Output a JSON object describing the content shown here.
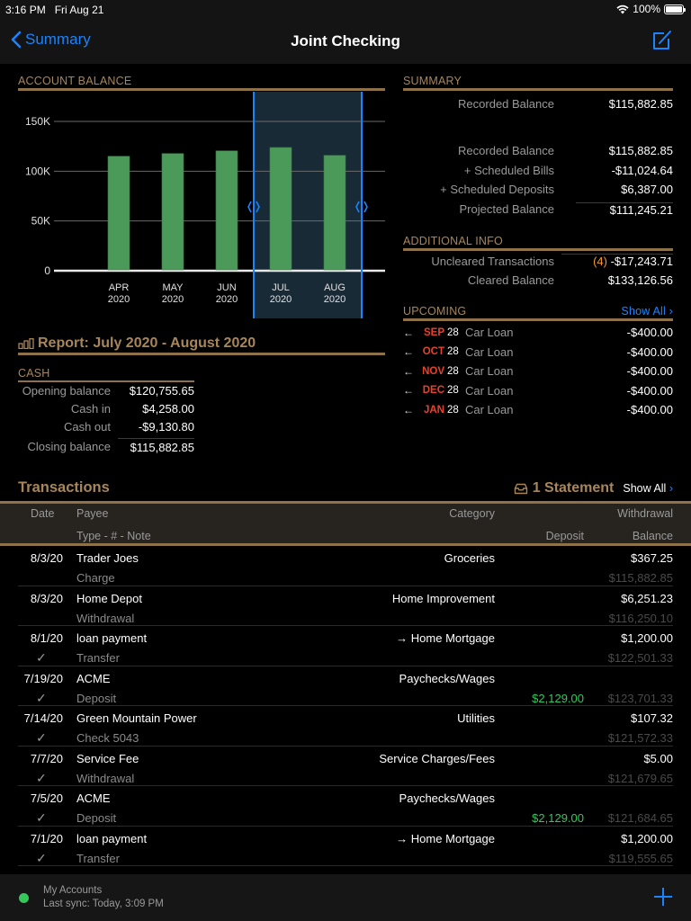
{
  "status_bar": {
    "time": "3:16 PM",
    "date": "Fri Aug 21",
    "battery": "100%",
    "battery_level": 1.0
  },
  "nav": {
    "back_label": "Summary",
    "title": "Joint Checking"
  },
  "colors": {
    "accent": "#1a84ff",
    "gold": "#a8865a",
    "bar": "#4c9a5a",
    "selection": "#192a37",
    "negative_month": "#e5432f",
    "positive": "#34c759",
    "warning": "#f09a28"
  },
  "account_balance": {
    "header": "ACCOUNT BALANCE"
  },
  "chart_data": {
    "type": "bar",
    "title": "ACCOUNT BALANCE",
    "categories": [
      "APR 2020",
      "MAY 2020",
      "JUN 2020",
      "JUL 2020",
      "AUG 2020"
    ],
    "category_lines": [
      [
        "APR",
        "2020"
      ],
      [
        "MAY",
        "2020"
      ],
      [
        "JUN",
        "2020"
      ],
      [
        "JUL",
        "2020"
      ],
      [
        "AUG",
        "2020"
      ]
    ],
    "values": [
      115000,
      117700,
      120400,
      123800,
      115882.85
    ],
    "ylim": [
      0,
      150000
    ],
    "yticks": [
      0,
      50000,
      100000,
      150000
    ],
    "ytick_labels": [
      "0",
      "50K",
      "100K",
      "150K"
    ],
    "grid": true,
    "selected_range": [
      "JUL 2020",
      "AUG 2020"
    ],
    "xlabel": "",
    "ylabel": ""
  },
  "summary": {
    "header": "SUMMARY",
    "top": {
      "label": "Recorded Balance",
      "value": "$115,882.85"
    },
    "rows": [
      {
        "label": "Recorded Balance",
        "value": "$115,882.85"
      },
      {
        "label": "+ Scheduled Bills",
        "value": "-$11,024.64"
      },
      {
        "label": "+ Scheduled Deposits",
        "value": "$6,387.00"
      },
      {
        "label": "Projected Balance",
        "value": "$111,245.21"
      }
    ]
  },
  "additional_info": {
    "header": "ADDITIONAL INFO",
    "uncleared": {
      "label": "Uncleared Transactions",
      "count": "(4)",
      "value": "-$17,243.71"
    },
    "cleared": {
      "label": "Cleared Balance",
      "value": "$133,126.56"
    }
  },
  "upcoming": {
    "header": "UPCOMING",
    "show_all": "Show All",
    "items": [
      {
        "month": "SEP",
        "day": "28",
        "name": "Car Loan",
        "amount": "-$400.00"
      },
      {
        "month": "OCT",
        "day": "28",
        "name": "Car Loan",
        "amount": "-$400.00"
      },
      {
        "month": "NOV",
        "day": "28",
        "name": "Car Loan",
        "amount": "-$400.00"
      },
      {
        "month": "DEC",
        "day": "28",
        "name": "Car Loan",
        "amount": "-$400.00"
      },
      {
        "month": "JAN",
        "day": "28",
        "name": "Car Loan",
        "amount": "-$400.00"
      }
    ]
  },
  "report": {
    "title": "Report: July 2020 - August 2020",
    "cash_header": "CASH",
    "rows": [
      {
        "label": "Opening balance",
        "value": "$120,755.65"
      },
      {
        "label": "Cash in",
        "value": "$4,258.00"
      },
      {
        "label": "Cash out",
        "value": "-$9,130.80"
      },
      {
        "label": "Closing balance",
        "value": "$115,882.85"
      }
    ]
  },
  "transactions": {
    "title": "Transactions",
    "statement_label": "1 Statement",
    "show_all": "Show All",
    "columns": {
      "date": "Date",
      "payee": "Payee",
      "type_note": "Type - # - Note",
      "category": "Category",
      "withdrawal": "Withdrawal",
      "deposit": "Deposit",
      "balance": "Balance"
    },
    "rows": [
      {
        "date": "8/3/20",
        "cleared": "",
        "payee": "Trader Joes",
        "type": "Charge",
        "category": "Groceries",
        "withdrawal": "$367.25",
        "deposit": "",
        "balance": "$115,882.85"
      },
      {
        "date": "8/3/20",
        "cleared": "",
        "payee": "Home Depot",
        "type": "Withdrawal",
        "category": "Home Improvement",
        "withdrawal": "$6,251.23",
        "deposit": "",
        "balance": "$116,250.10"
      },
      {
        "date": "8/1/20",
        "cleared": "✓",
        "payee": "loan payment",
        "type": "Transfer",
        "category": "→ Home Mortgage",
        "withdrawal": "$1,200.00",
        "deposit": "",
        "balance": "$122,501.33"
      },
      {
        "date": "7/19/20",
        "cleared": "✓",
        "payee": "ACME",
        "type": "Deposit",
        "category": "Paychecks/Wages",
        "withdrawal": "",
        "deposit": "$2,129.00",
        "balance": "$123,701.33"
      },
      {
        "date": "7/14/20",
        "cleared": "✓",
        "payee": "Green Mountain Power",
        "type": "Check 5043",
        "category": "Utilities",
        "withdrawal": "$107.32",
        "deposit": "",
        "balance": "$121,572.33"
      },
      {
        "date": "7/7/20",
        "cleared": "✓",
        "payee": "Service Fee",
        "type": "Withdrawal",
        "category": "Service Charges/Fees",
        "withdrawal": "$5.00",
        "deposit": "",
        "balance": "$121,679.65"
      },
      {
        "date": "7/5/20",
        "cleared": "✓",
        "payee": "ACME",
        "type": "Deposit",
        "category": "Paychecks/Wages",
        "withdrawal": "",
        "deposit": "$2,129.00",
        "balance": "$121,684.65"
      },
      {
        "date": "7/1/20",
        "cleared": "✓",
        "payee": "loan payment",
        "type": "Transfer",
        "category": "→ Home Mortgage",
        "withdrawal": "$1,200.00",
        "deposit": "",
        "balance": "$119,555.65"
      }
    ]
  },
  "bottom_bar": {
    "accounts_label": "My Accounts",
    "sync_label": "Last sync: Today, 3:09 PM"
  }
}
